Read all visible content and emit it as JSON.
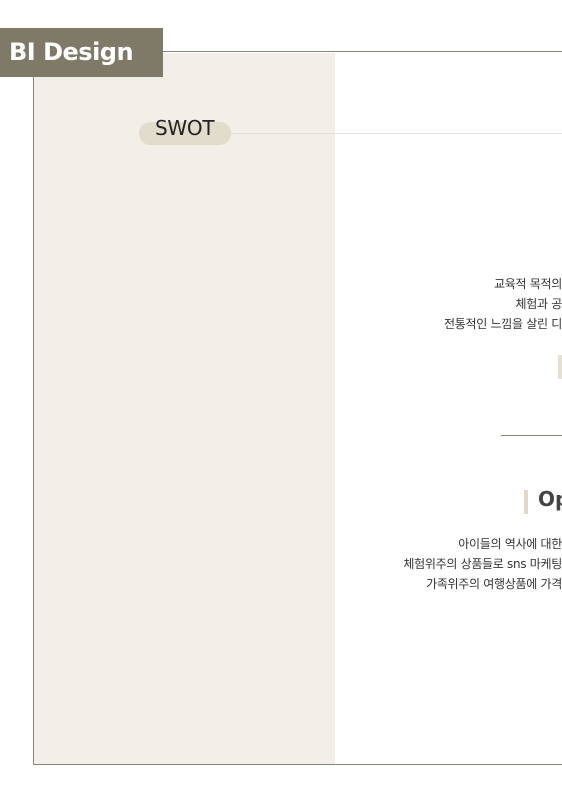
{
  "badge": {
    "title": "BI Design"
  },
  "section": {
    "label": "SWOT"
  },
  "block1": {
    "lines": [
      "교육적 목적의",
      "체험과 공",
      "전통적인 느낌을 살린 디"
    ]
  },
  "block2": {
    "heading": "Op",
    "lines": [
      "아이들의 역사에 대한",
      "체험위주의 상품들로 sns 마케팅",
      "가족위주의 여행상품에 가격"
    ]
  },
  "colors": {
    "badge": "#7f7a67",
    "panel": "#f2eee8",
    "pill": "#e2dccd",
    "rule": "#8a8676"
  }
}
